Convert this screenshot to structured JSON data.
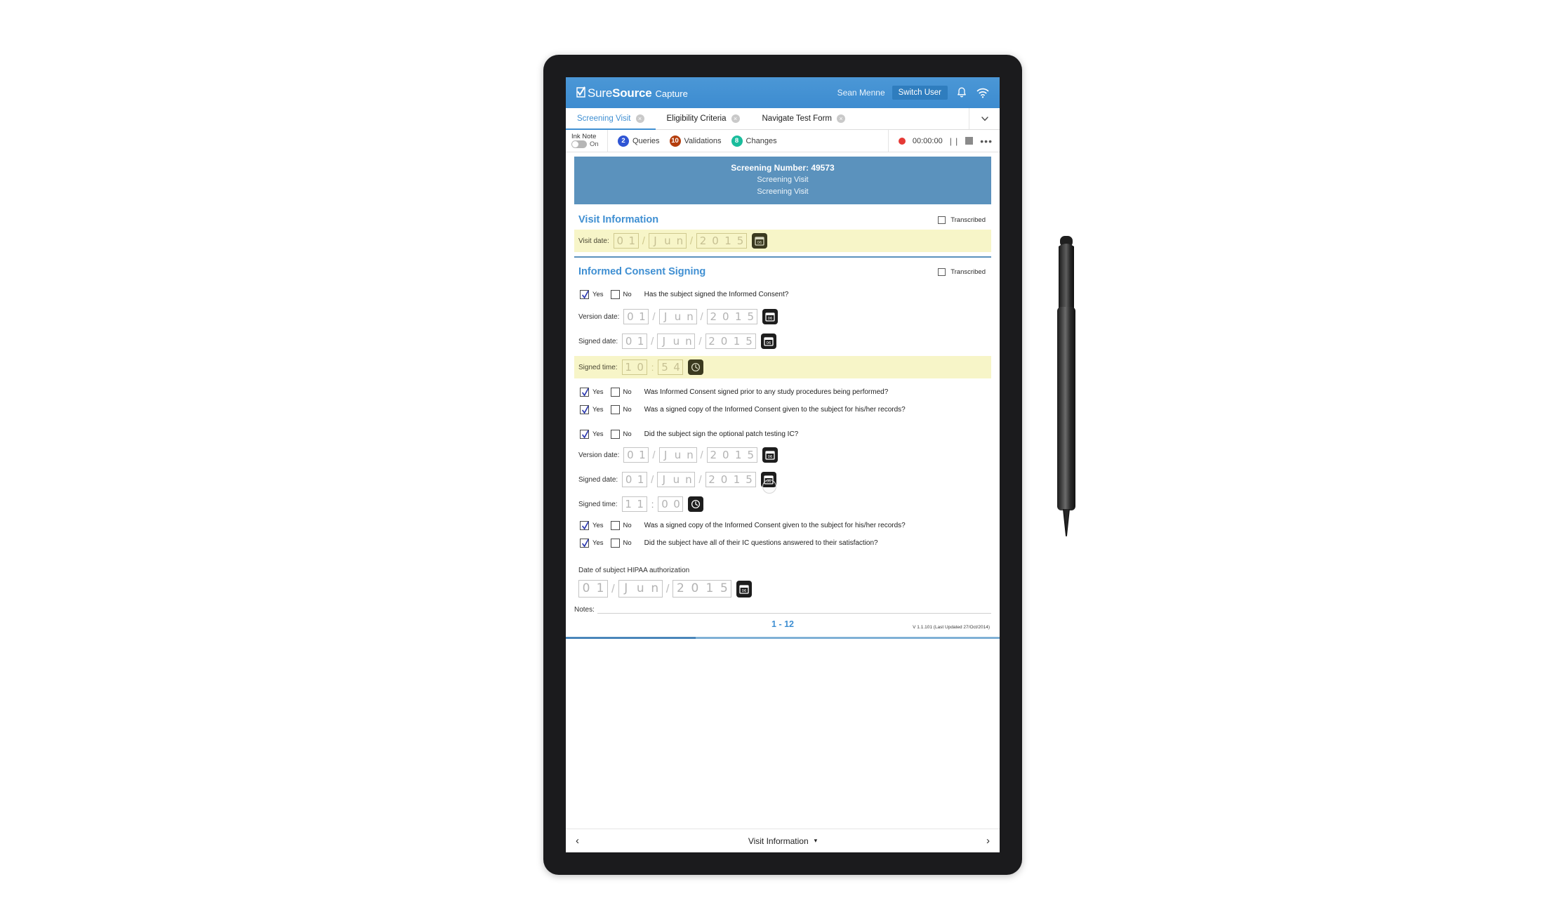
{
  "app": {
    "brand_sure": "Sure",
    "brand_source": "Source",
    "brand_capture": "Capture",
    "user_name": "Sean Menne",
    "switch_user_label": "Switch User",
    "accent_blue": "#3f8fd2",
    "banner_blue": "#5b92bd"
  },
  "tabs": [
    {
      "label": "Screening Visit",
      "close": "×",
      "active": true
    },
    {
      "label": "Eligibility Criteria",
      "close": "×",
      "active": false
    },
    {
      "label": "Navigate Test Form",
      "close": "×",
      "active": false
    }
  ],
  "toolbar": {
    "ink_note_label": "Ink Note",
    "ink_note_state": "On",
    "queries_count": "2",
    "queries_label": "Queries",
    "queries_color": "#2f55d4",
    "validations_count": "10",
    "validations_label": "Validations",
    "validations_color": "#b43d0c",
    "changes_count": "8",
    "changes_label": "Changes",
    "changes_color": "#1abc9c",
    "rec_time": "00:00:00",
    "rec_color": "#e53935",
    "pause_glyph": "| |",
    "more_glyph": "•••"
  },
  "banner": {
    "screening_number": "Screening Number: 49573",
    "line2": "Screening Visit",
    "line3": "Screening Visit"
  },
  "sections": {
    "visit_information": {
      "title": "Visit Information",
      "transcribed_label": "Transcribed",
      "visit_date_label": "Visit date:",
      "visit_date": {
        "d1": "0",
        "d2": "1",
        "m1": "J",
        "m2": "u",
        "m3": "n",
        "y1": "2",
        "y2": "0",
        "y3": "1",
        "y4": "5"
      }
    },
    "informed_consent": {
      "title": "Informed Consent Signing",
      "transcribed_label": "Transcribed",
      "yes_label": "Yes",
      "no_label": "No",
      "q1": "Has the subject signed the Informed Consent?",
      "version_date_label": "Version date:",
      "version_date": {
        "d1": "0",
        "d2": "1",
        "m1": "J",
        "m2": "u",
        "m3": "n",
        "y1": "2",
        "y2": "0",
        "y3": "1",
        "y4": "5"
      },
      "signed_date_label": "Signed date:",
      "signed_date": {
        "d1": "0",
        "d2": "1",
        "m1": "J",
        "m2": "u",
        "m3": "n",
        "y1": "2",
        "y2": "0",
        "y3": "1",
        "y4": "5"
      },
      "signed_time_label": "Signed time:",
      "signed_time": {
        "h1": "1",
        "h2": "0",
        "mi1": "5",
        "mi2": "4"
      },
      "q2": "Was Informed Consent signed prior to any study procedures being performed?",
      "q3": "Was a signed copy of the Informed Consent given to the subject for his/her records?",
      "q4": "Did the subject sign the optional patch testing IC?",
      "version_date2_label": "Version date:",
      "version_date2": {
        "d1": "0",
        "d2": "1",
        "m1": "J",
        "m2": "u",
        "m3": "n",
        "y1": "2",
        "y2": "0",
        "y3": "1",
        "y4": "5"
      },
      "signed_date2_label": "Signed date:",
      "signed_date2": {
        "d1": "0",
        "d2": "1",
        "m1": "J",
        "m2": "u",
        "m3": "n",
        "y1": "2",
        "y2": "0",
        "y3": "1",
        "y4": "5"
      },
      "signed_time2_label": "Signed time:",
      "signed_time2": {
        "h1": "1",
        "h2": "1",
        "mi1": "0",
        "mi2": "0"
      },
      "q5": "Was a signed copy of the Informed Consent given to the subject for his/her records?",
      "q6": "Did the subject have all of their IC questions answered to their satisfaction?",
      "hipaa_label": "Date of subject HIPAA authorization",
      "hipaa_date": {
        "d1": "0",
        "d2": "1",
        "m1": "J",
        "m2": "u",
        "m3": "n",
        "y1": "2",
        "y2": "0",
        "y3": "1",
        "y4": "5"
      },
      "notes_label": "Notes:"
    }
  },
  "pager": {
    "page_range": "1 - 12",
    "version_text": "V 1.1.101 (Last Updated 27/Oct/2014)",
    "progress_percent": "30"
  },
  "bottom": {
    "prev_glyph": "‹",
    "next_glyph": "›",
    "section_name": "Visit Information",
    "chevron": "▾"
  },
  "calendar_icon_text": "06"
}
